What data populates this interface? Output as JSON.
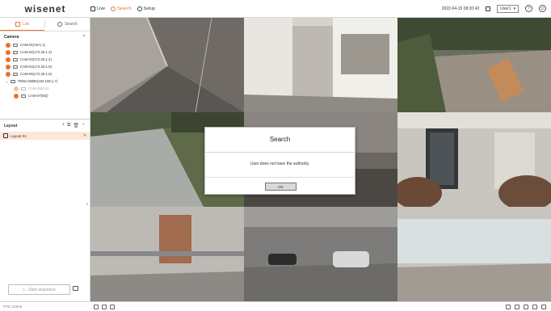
{
  "app": {
    "logo": "wisenet"
  },
  "topnav": [
    {
      "label": "Live",
      "icon": "monitor-icon",
      "active": false
    },
    {
      "label": "Search",
      "icon": "search-icon",
      "active": true
    },
    {
      "label": "Setup",
      "icon": "gear-icon",
      "active": false
    }
  ],
  "topbar": {
    "datetime": "2022-04-15 08:20:43",
    "user": "User1"
  },
  "sidebar": {
    "tabs": [
      {
        "label": "List",
        "active": true
      },
      {
        "label": "Search",
        "active": false
      }
    ],
    "camera_title": "Camera",
    "cameras": [
      {
        "label": "CAM-01(Ver1.1)",
        "indent": false,
        "dim": false
      },
      {
        "label": "CAM-02(172.30.1.2)",
        "indent": false,
        "dim": false
      },
      {
        "label": "CAM-03(172.30.1.4)",
        "indent": false,
        "dim": false
      },
      {
        "label": "CAM-04(172.30.1.5)",
        "indent": false,
        "dim": false
      },
      {
        "label": "CAM-05(172.30.1.6)",
        "indent": false,
        "dim": false
      },
      {
        "label": "PNM-A9080(192.168.1.7)",
        "indent": false,
        "dim": false
      },
      {
        "label": "CAM-06(ch1)",
        "indent": true,
        "dim": true
      },
      {
        "label": "CAM-07(M2)",
        "indent": true,
        "dim": false
      }
    ],
    "layout_title": "Layout",
    "layout_item": "Layout 01",
    "sequence_button": "Start sequence"
  },
  "bottombar": {
    "left_label": "PTZ control"
  },
  "dialog": {
    "title": "Search",
    "message": "User does not have the authority.",
    "ok": "OK"
  },
  "colors": {
    "accent": "#e8722c",
    "layout_highlight": "#fde7d9"
  }
}
